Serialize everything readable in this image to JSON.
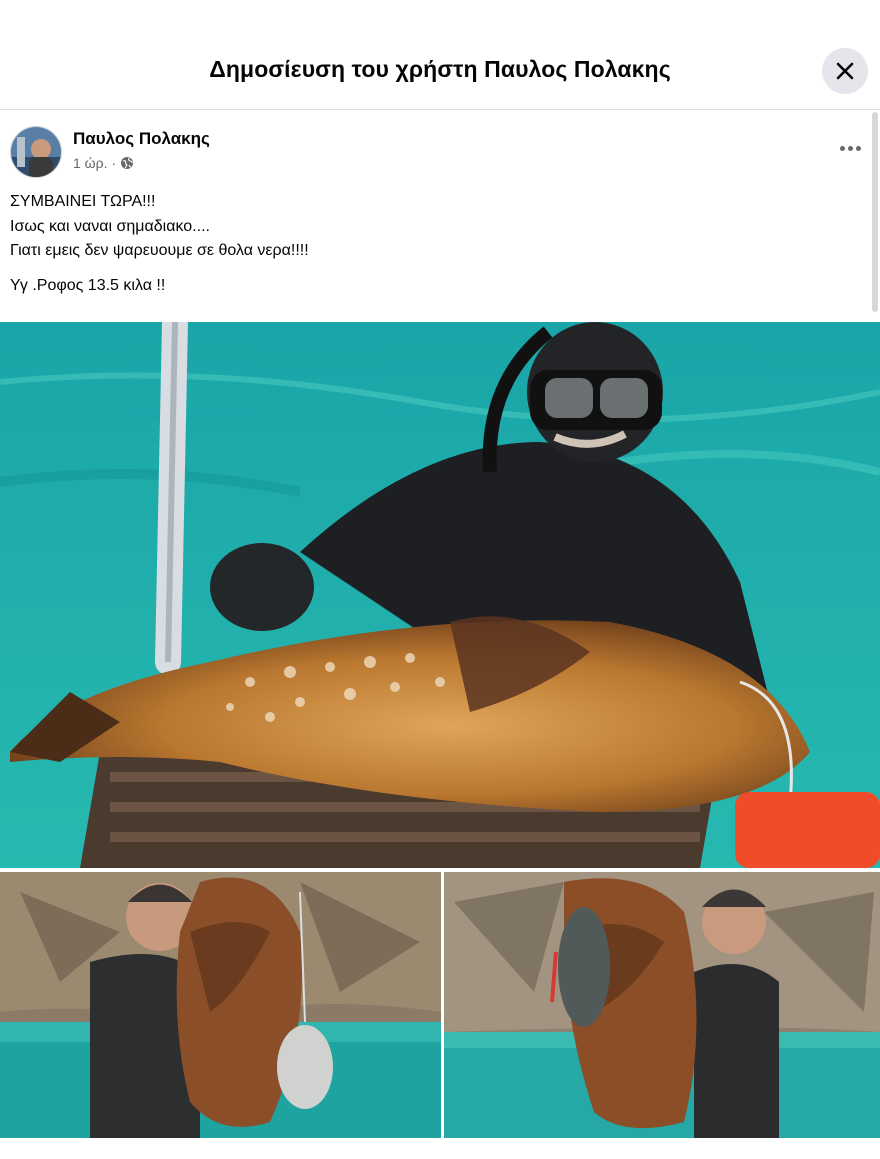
{
  "dialog": {
    "title": "Δημοσίευση του χρήστη Παυλος Πολακης",
    "close_icon": "close-icon"
  },
  "post": {
    "author": "Παυλος Πολακης",
    "time": "1 ώρ.",
    "separator": "·",
    "audience_icon": "globe-icon",
    "more_icon": "more-horizontal-icon",
    "text_lines": [
      "ΣΥΜΒΑΙΝΕΙ ΤΩΡΑ!!!",
      "Ισως και ναναι σημαδιακο....",
      "Γιατι εμεις δεν ψαρευουμε σε θολα νερα!!!!"
    ],
    "ps_line": "Υγ .Ροφος 13.5 κιλα !!"
  },
  "photos": [
    {
      "name": "photo-diver-with-grouper-on-boat-ladder"
    },
    {
      "name": "photo-man-holding-grouper-left"
    },
    {
      "name": "photo-man-holding-grouper-right"
    }
  ],
  "colors": {
    "header_bg": "#ffffff",
    "close_bg": "#e4e6eb",
    "secondary_text": "#65676b",
    "water": "#1fa7a6"
  }
}
